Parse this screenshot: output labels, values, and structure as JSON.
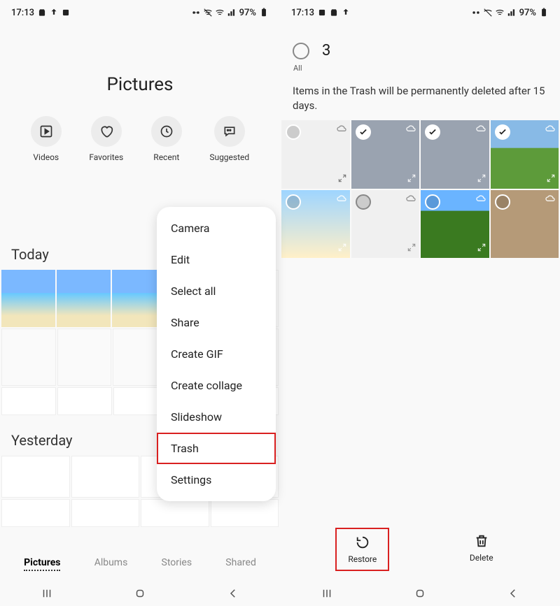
{
  "statusbar": {
    "time": "17:13",
    "battery": "97%"
  },
  "left": {
    "title": "Pictures",
    "cats": [
      {
        "label": "Videos"
      },
      {
        "label": "Favorites"
      },
      {
        "label": "Recent"
      },
      {
        "label": "Suggested"
      }
    ],
    "sections": {
      "today": "Today",
      "yesterday": "Yesterday"
    },
    "tabs": [
      {
        "label": "Pictures",
        "active": true
      },
      {
        "label": "Albums",
        "active": false
      },
      {
        "label": "Stories",
        "active": false
      },
      {
        "label": "Shared",
        "active": false
      }
    ],
    "menu": [
      "Camera",
      "Edit",
      "Select all",
      "Share",
      "Create GIF",
      "Create collage",
      "Slideshow",
      "Trash",
      "Settings"
    ],
    "menu_highlight": "Trash"
  },
  "right": {
    "all_label": "All",
    "count": "3",
    "message": "Items in the Trash will be permanently deleted after 15 days.",
    "actions": {
      "restore": "Restore",
      "delete": "Delete"
    },
    "action_highlight": "Restore"
  }
}
